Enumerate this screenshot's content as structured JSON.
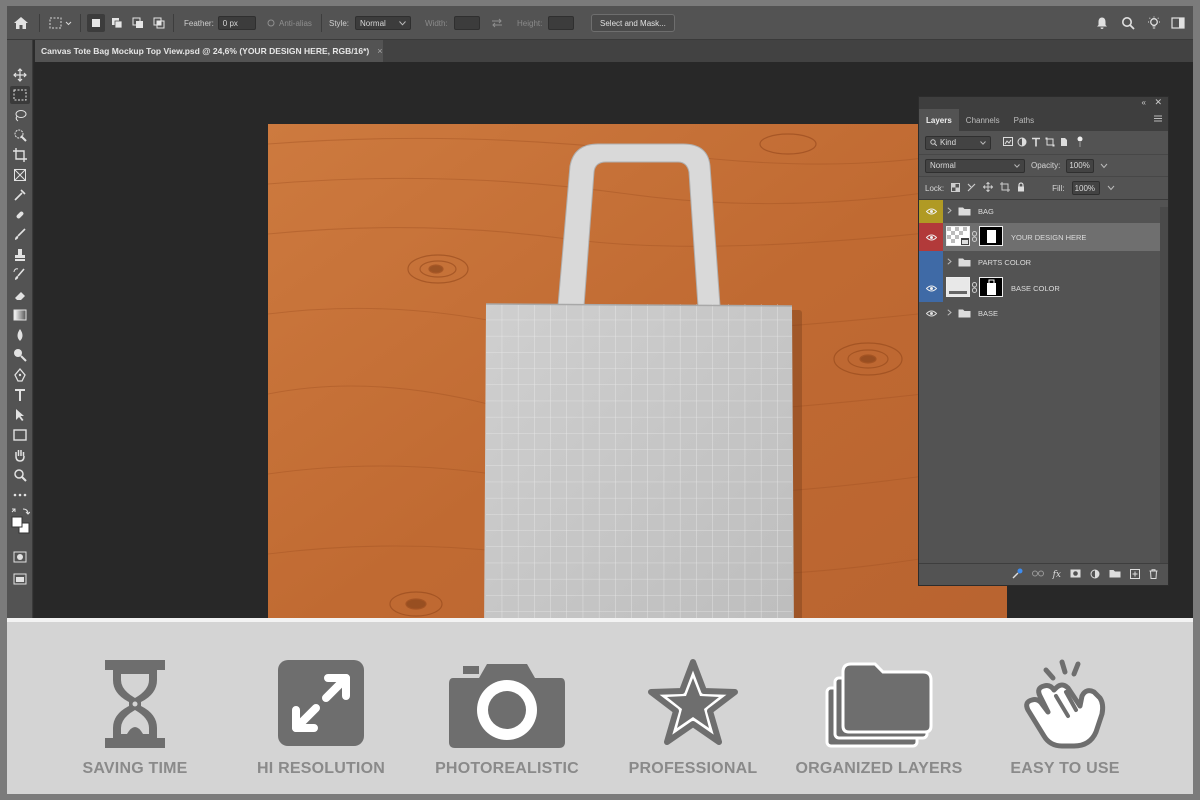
{
  "options_bar": {
    "feather_label": "Feather:",
    "feather_value": "0 px",
    "anti_alias_label": "Anti-alias",
    "style_label": "Style:",
    "style_value": "Normal",
    "width_label": "Width:",
    "height_label": "Height:",
    "select_mask_label": "Select and Mask..."
  },
  "document": {
    "tab_title": "Canvas Tote Bag Mockup Top View.psd @ 24,6% (YOUR DESIGN HERE, RGB/16*)",
    "close_glyph": "×"
  },
  "layers_panel": {
    "tabs": [
      "Layers",
      "Channels",
      "Paths"
    ],
    "filter_value": "Kind",
    "blend_mode": "Normal",
    "opacity_label": "Opacity:",
    "opacity_value": "100%",
    "lock_label": "Lock:",
    "fill_label": "Fill:",
    "fill_value": "100%",
    "layers": [
      {
        "name": "BAG",
        "kind": "group",
        "color": "#b09a24",
        "visible": true
      },
      {
        "name": "YOUR DESIGN HERE",
        "kind": "smart-object",
        "color": "#b23a3a",
        "visible": true,
        "selected": true
      },
      {
        "name": "PARTS COLOR",
        "kind": "group",
        "color": "#3f6aa6",
        "visible": false
      },
      {
        "name": "BASE COLOR",
        "kind": "fill-layer",
        "color": "#3f6aa6",
        "visible": true
      },
      {
        "name": "BASE",
        "kind": "group",
        "color": null,
        "visible": true
      }
    ]
  },
  "features": [
    {
      "label": "SAVING TIME",
      "icon": "hourglass-icon"
    },
    {
      "label": "HI RESOLUTION",
      "icon": "expand-arrows-icon"
    },
    {
      "label": "PHOTOREALISTIC",
      "icon": "camera-icon"
    },
    {
      "label": "PROFESSIONAL",
      "icon": "star-icon"
    },
    {
      "label": "ORGANIZED LAYERS",
      "icon": "folder-stack-icon"
    },
    {
      "label": "EASY TO USE",
      "icon": "pointing-hand-icon"
    }
  ],
  "colors": {
    "workspace": "#2b2b2b",
    "panel": "#535353",
    "wood": "#c36f36",
    "feature_icon": "#6e6e6e",
    "feature_label": "#8a8a8a"
  }
}
